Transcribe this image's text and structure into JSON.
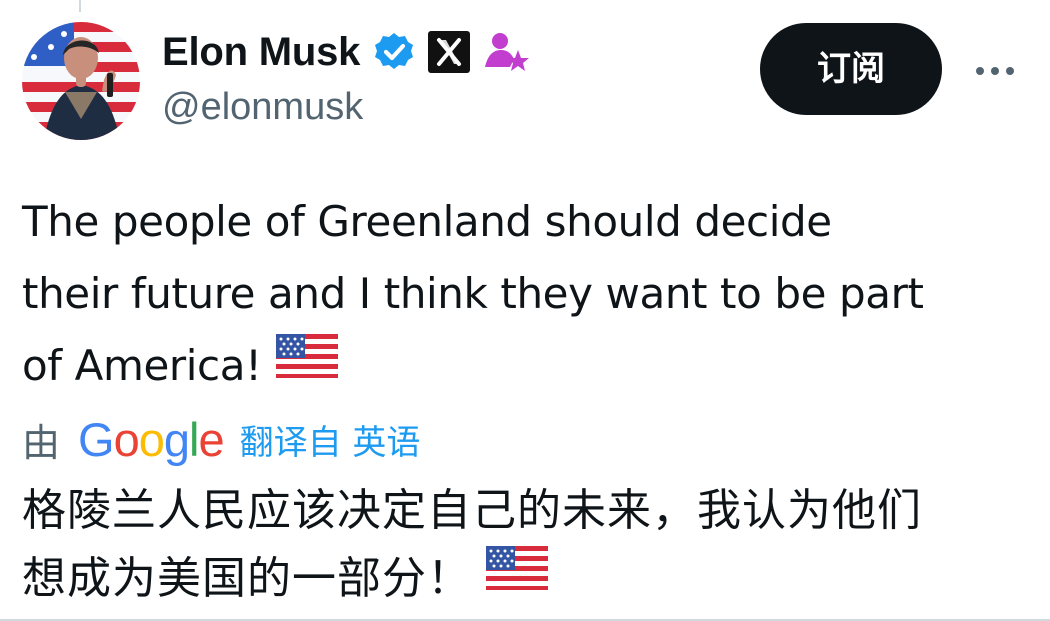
{
  "author": {
    "display_name": "Elon Musk",
    "handle": "@elonmusk",
    "affiliate_label": "X"
  },
  "actions": {
    "subscribe_label": "订阅",
    "more_label": "···"
  },
  "tweet": {
    "lines": [
      "The people of Greenland should decide",
      "their future and I think they want to be part",
      "of America!"
    ]
  },
  "translation": {
    "prefix": "由",
    "provider_letters": [
      "G",
      "o",
      "o",
      "g",
      "l",
      "e"
    ],
    "link_label": "翻译自 英语",
    "lines": [
      "格陵兰人民应该决定自己的未来，我认为他们",
      "想成为美国的一部分！"
    ]
  },
  "colors": {
    "text": "#0f1419",
    "muted": "#536471",
    "verified": "#1d9bf0",
    "member_badge": "#c13ecf",
    "subscribe_bg": "#0f1419"
  },
  "icons": {
    "verified": "verified-badge-icon",
    "affiliate": "x-logo-icon",
    "member": "member-badge-icon",
    "flag": "us-flag-icon",
    "more": "more-horizontal-icon"
  }
}
